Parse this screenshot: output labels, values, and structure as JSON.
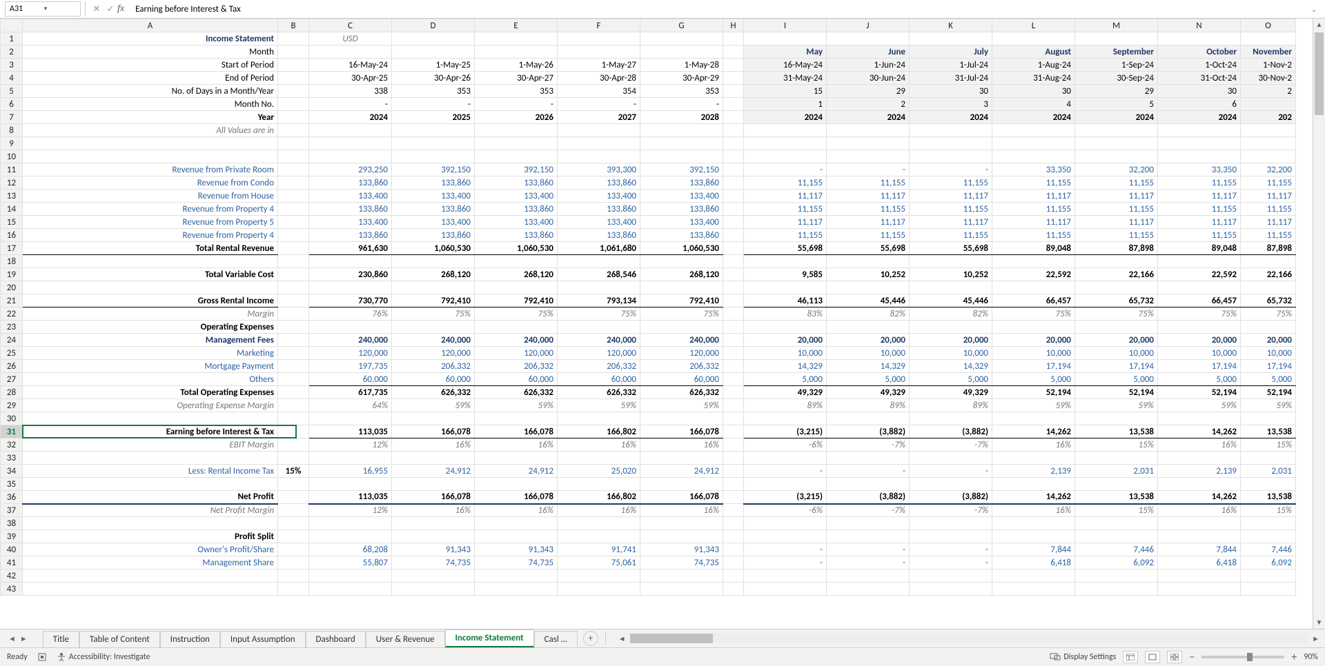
{
  "formula_bar": {
    "cell_ref": "A31",
    "fx": "fx",
    "formula": "Earning before Interest & Tax"
  },
  "columns": [
    "A",
    "B",
    "C",
    "D",
    "E",
    "F",
    "G",
    "H",
    "I",
    "J",
    "K",
    "L",
    "M",
    "N",
    "O"
  ],
  "row_count": 43,
  "tabs": [
    "Title",
    "Table of Content",
    "Instruction",
    "Input Assumption",
    "Dashboard",
    "User & Revenue",
    "Income Statement",
    "Casl …"
  ],
  "active_tab": 6,
  "status": {
    "ready": "Ready",
    "access": "Accessibility: Investigate",
    "display": "Display Settings",
    "zoom": "90%"
  },
  "rows": {
    "1": {
      "A": "Income Statement",
      "C": "USD"
    },
    "2": {
      "A": "Month",
      "I": "May",
      "J": "June",
      "K": "July",
      "L": "August",
      "M": "September",
      "N": "October",
      "O": "November"
    },
    "3": {
      "A": "Start of Period",
      "C": "16-May-24",
      "D": "1-May-25",
      "E": "1-May-26",
      "F": "1-May-27",
      "G": "1-May-28",
      "I": "16-May-24",
      "J": "1-Jun-24",
      "K": "1-Jul-24",
      "L": "1-Aug-24",
      "M": "1-Sep-24",
      "N": "1-Oct-24",
      "O": "1-Nov-2"
    },
    "4": {
      "A": "End of Period",
      "C": "30-Apr-25",
      "D": "30-Apr-26",
      "E": "30-Apr-27",
      "F": "30-Apr-28",
      "G": "30-Apr-29",
      "I": "31-May-24",
      "J": "30-Jun-24",
      "K": "31-Jul-24",
      "L": "31-Aug-24",
      "M": "30-Sep-24",
      "N": "31-Oct-24",
      "O": "30-Nov-2"
    },
    "5": {
      "A": "No. of Days in a Month/Year",
      "C": "338",
      "D": "353",
      "E": "353",
      "F": "354",
      "G": "353",
      "I": "15",
      "J": "29",
      "K": "30",
      "L": "30",
      "M": "29",
      "N": "30",
      "O": "2"
    },
    "6": {
      "A": "Month No.",
      "C": "-",
      "D": "-",
      "E": "-",
      "F": "-",
      "G": "-",
      "I": "1",
      "J": "2",
      "K": "3",
      "L": "4",
      "M": "5",
      "N": "6"
    },
    "7": {
      "A": "Year",
      "C": "2024",
      "D": "2025",
      "E": "2026",
      "F": "2027",
      "G": "2028",
      "I": "2024",
      "J": "2024",
      "K": "2024",
      "L": "2024",
      "M": "2024",
      "N": "2024",
      "O": "202"
    },
    "8": {
      "A": "All Values are in"
    },
    "11": {
      "A": "Revenue from Private Room",
      "C": "293,250",
      "D": "392,150",
      "E": "392,150",
      "F": "393,300",
      "G": "392,150",
      "I": "-",
      "J": "-",
      "K": "-",
      "L": "33,350",
      "M": "32,200",
      "N": "33,350",
      "O": "32,200"
    },
    "12": {
      "A": "Revenue from Condo",
      "C": "133,860",
      "D": "133,860",
      "E": "133,860",
      "F": "133,860",
      "G": "133,860",
      "I": "11,155",
      "J": "11,155",
      "K": "11,155",
      "L": "11,155",
      "M": "11,155",
      "N": "11,155",
      "O": "11,155"
    },
    "13": {
      "A": "Revenue from House",
      "C": "133,400",
      "D": "133,400",
      "E": "133,400",
      "F": "133,400",
      "G": "133,400",
      "I": "11,117",
      "J": "11,117",
      "K": "11,117",
      "L": "11,117",
      "M": "11,117",
      "N": "11,117",
      "O": "11,117"
    },
    "14": {
      "A": "Revenue from Property 4",
      "C": "133,860",
      "D": "133,860",
      "E": "133,860",
      "F": "133,860",
      "G": "133,860",
      "I": "11,155",
      "J": "11,155",
      "K": "11,155",
      "L": "11,155",
      "M": "11,155",
      "N": "11,155",
      "O": "11,155"
    },
    "15": {
      "A": "Revenue from Property 5",
      "C": "133,400",
      "D": "133,400",
      "E": "133,400",
      "F": "133,400",
      "G": "133,400",
      "I": "11,117",
      "J": "11,117",
      "K": "11,117",
      "L": "11,117",
      "M": "11,117",
      "N": "11,117",
      "O": "11,117"
    },
    "16": {
      "A": "Revenue from Property 4",
      "C": "133,860",
      "D": "133,860",
      "E": "133,860",
      "F": "133,860",
      "G": "133,860",
      "I": "11,155",
      "J": "11,155",
      "K": "11,155",
      "L": "11,155",
      "M": "11,155",
      "N": "11,155",
      "O": "11,155"
    },
    "17": {
      "A": "Total Rental Revenue",
      "C": "961,630",
      "D": "1,060,530",
      "E": "1,060,530",
      "F": "1,061,680",
      "G": "1,060,530",
      "I": "55,698",
      "J": "55,698",
      "K": "55,698",
      "L": "89,048",
      "M": "87,898",
      "N": "89,048",
      "O": "87,898"
    },
    "19": {
      "A": "Total Variable Cost",
      "C": "230,860",
      "D": "268,120",
      "E": "268,120",
      "F": "268,546",
      "G": "268,120",
      "I": "9,585",
      "J": "10,252",
      "K": "10,252",
      "L": "22,592",
      "M": "22,166",
      "N": "22,592",
      "O": "22,166"
    },
    "21": {
      "A": "Gross Rental Income",
      "C": "730,770",
      "D": "792,410",
      "E": "792,410",
      "F": "793,134",
      "G": "792,410",
      "I": "46,113",
      "J": "45,446",
      "K": "45,446",
      "L": "66,457",
      "M": "65,732",
      "N": "66,457",
      "O": "65,732"
    },
    "22": {
      "A": "Margin",
      "C": "76%",
      "D": "75%",
      "E": "75%",
      "F": "75%",
      "G": "75%",
      "I": "83%",
      "J": "82%",
      "K": "82%",
      "L": "75%",
      "M": "75%",
      "N": "75%",
      "O": "75%"
    },
    "23": {
      "A": "Operating Expenses"
    },
    "24": {
      "A": "Management Fees",
      "C": "240,000",
      "D": "240,000",
      "E": "240,000",
      "F": "240,000",
      "G": "240,000",
      "I": "20,000",
      "J": "20,000",
      "K": "20,000",
      "L": "20,000",
      "M": "20,000",
      "N": "20,000",
      "O": "20,000"
    },
    "25": {
      "A": "Marketing",
      "C": "120,000",
      "D": "120,000",
      "E": "120,000",
      "F": "120,000",
      "G": "120,000",
      "I": "10,000",
      "J": "10,000",
      "K": "10,000",
      "L": "10,000",
      "M": "10,000",
      "N": "10,000",
      "O": "10,000"
    },
    "26": {
      "A": "Mortgage Payment",
      "C": "197,735",
      "D": "206,332",
      "E": "206,332",
      "F": "206,332",
      "G": "206,332",
      "I": "14,329",
      "J": "14,329",
      "K": "14,329",
      "L": "17,194",
      "M": "17,194",
      "N": "17,194",
      "O": "17,194"
    },
    "27": {
      "A": "Others",
      "C": "60,000",
      "D": "60,000",
      "E": "60,000",
      "F": "60,000",
      "G": "60,000",
      "I": "5,000",
      "J": "5,000",
      "K": "5,000",
      "L": "5,000",
      "M": "5,000",
      "N": "5,000",
      "O": "5,000"
    },
    "28": {
      "A": "Total Operating Expenses",
      "C": "617,735",
      "D": "626,332",
      "E": "626,332",
      "F": "626,332",
      "G": "626,332",
      "I": "49,329",
      "J": "49,329",
      "K": "49,329",
      "L": "52,194",
      "M": "52,194",
      "N": "52,194",
      "O": "52,194"
    },
    "29": {
      "A": "Operating Expense Margin",
      "C": "64%",
      "D": "59%",
      "E": "59%",
      "F": "59%",
      "G": "59%",
      "I": "89%",
      "J": "89%",
      "K": "89%",
      "L": "59%",
      "M": "59%",
      "N": "59%",
      "O": "59%"
    },
    "31": {
      "A": "Earning before Interest & Tax",
      "C": "113,035",
      "D": "166,078",
      "E": "166,078",
      "F": "166,802",
      "G": "166,078",
      "I": "(3,215)",
      "J": "(3,882)",
      "K": "(3,882)",
      "L": "14,262",
      "M": "13,538",
      "N": "14,262",
      "O": "13,538"
    },
    "32": {
      "A": "EBIT Margin",
      "C": "12%",
      "D": "16%",
      "E": "16%",
      "F": "16%",
      "G": "16%",
      "I": "-6%",
      "J": "-7%",
      "K": "-7%",
      "L": "16%",
      "M": "15%",
      "N": "16%",
      "O": "15%"
    },
    "34": {
      "A": "Less: Rental Income Tax",
      "B": "15%",
      "C": "16,955",
      "D": "24,912",
      "E": "24,912",
      "F": "25,020",
      "G": "24,912",
      "I": "-",
      "J": "-",
      "K": "-",
      "L": "2,139",
      "M": "2,031",
      "N": "2,139",
      "O": "2,031"
    },
    "36": {
      "A": "Net Profit",
      "C": "113,035",
      "D": "166,078",
      "E": "166,078",
      "F": "166,802",
      "G": "166,078",
      "I": "(3,215)",
      "J": "(3,882)",
      "K": "(3,882)",
      "L": "14,262",
      "M": "13,538",
      "N": "14,262",
      "O": "13,538"
    },
    "37": {
      "A": "Net Profit Margin",
      "C": "12%",
      "D": "16%",
      "E": "16%",
      "F": "16%",
      "G": "16%",
      "I": "-6%",
      "J": "-7%",
      "K": "-7%",
      "L": "16%",
      "M": "15%",
      "N": "16%",
      "O": "15%"
    },
    "39": {
      "A": "Profit Split"
    },
    "40": {
      "A": "Owner's Profit/Share",
      "C": "68,208",
      "D": "91,343",
      "E": "91,343",
      "F": "91,741",
      "G": "91,343",
      "I": "-",
      "J": "-",
      "K": "-",
      "L": "7,844",
      "M": "7,446",
      "N": "7,844",
      "O": "7,446"
    },
    "41": {
      "A": "Management Share",
      "C": "55,807",
      "D": "74,735",
      "E": "74,735",
      "F": "75,061",
      "G": "74,735",
      "I": "-",
      "J": "-",
      "K": "-",
      "L": "6,418",
      "M": "6,092",
      "N": "6,418",
      "O": "6,092"
    }
  },
  "row_styles": {
    "1": {
      "A": "title right",
      "C": "italic center"
    },
    "2": {
      "A": "right",
      "shadeMon": true,
      "mon": "hdrBlue right"
    },
    "7": {
      "A": "right bold",
      "num": "bold right"
    },
    "8": {
      "A": "right italic"
    },
    "rev": {
      "A": "right blue",
      "num": "right val"
    },
    "17": {
      "A": "right bold",
      "num": "right bold",
      "border": "bt bb"
    },
    "19": {
      "A": "right bold",
      "num": "right bold"
    },
    "21": {
      "A": "right bold",
      "num": "right bold",
      "border": "bt bb"
    },
    "pct": {
      "A": "right italic",
      "num": "right pct"
    },
    "23": {
      "A": "right bold"
    },
    "24": {
      "A": "right hdrBlue",
      "num": "right hdrBlue bold"
    },
    "28": {
      "A": "right bold",
      "num": "right bold",
      "border": "bt"
    },
    "31": {
      "A": "right bold",
      "num": "right bold",
      "border": "bt bb"
    },
    "36": {
      "A": "right bold",
      "num": "right bold",
      "border": "bt bb-navy"
    },
    "39": {
      "A": "right bold"
    }
  }
}
